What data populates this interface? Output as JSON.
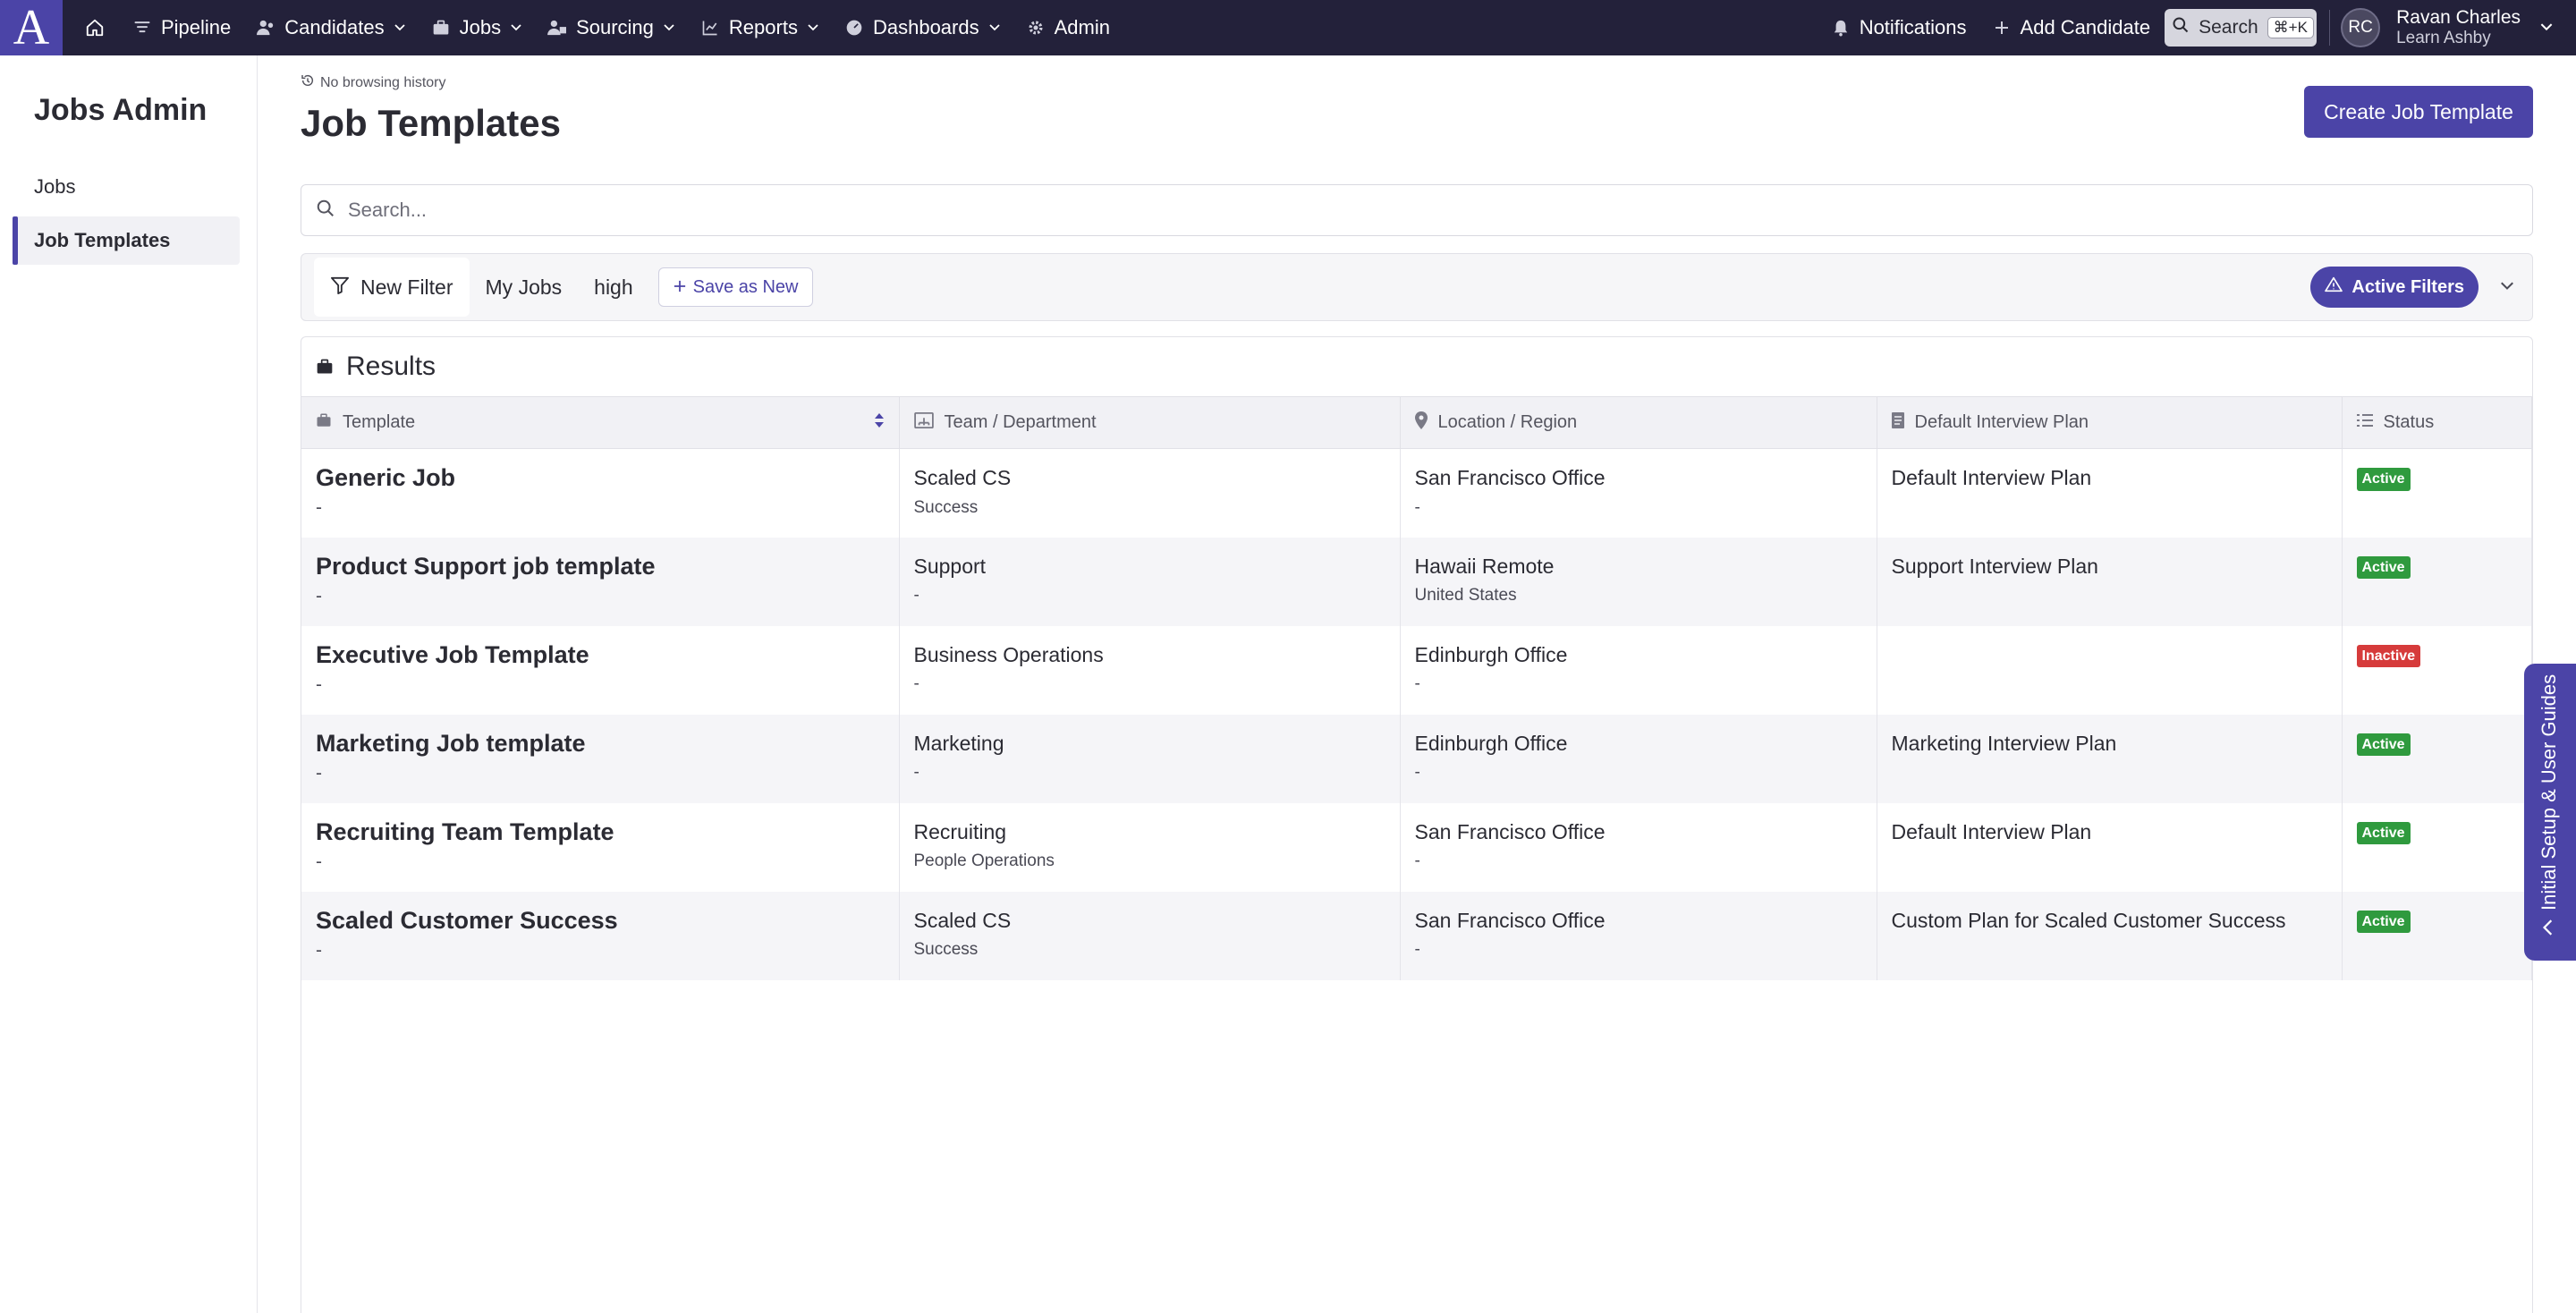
{
  "nav": {
    "logo": "A",
    "items": [
      {
        "label": "Pipeline",
        "icon": "filter-icon"
      },
      {
        "label": "Candidates",
        "icon": "users-icon"
      },
      {
        "label": "Jobs",
        "icon": "briefcase-icon"
      },
      {
        "label": "Sourcing",
        "icon": "sourcing-icon"
      },
      {
        "label": "Reports",
        "icon": "chart-line-icon"
      },
      {
        "label": "Dashboards",
        "icon": "gauge-icon"
      },
      {
        "label": "Admin",
        "icon": "gear-icon"
      }
    ],
    "notifications": "Notifications",
    "add_candidate": "Add Candidate",
    "search": "Search",
    "shortcut": "⌘+K",
    "user": {
      "initials": "RC",
      "name": "Ravan Charles",
      "org": "Learn Ashby"
    }
  },
  "sidebar": {
    "title": "Jobs Admin",
    "items": [
      {
        "label": "Jobs",
        "active": false
      },
      {
        "label": "Job Templates",
        "active": true
      }
    ]
  },
  "main": {
    "history": "No browsing history",
    "title": "Job Templates",
    "create_button": "Create Job Template",
    "search_placeholder": "Search...",
    "filters": {
      "tabs": [
        "New Filter",
        "My Jobs",
        "high"
      ],
      "save_as_new": "Save as New",
      "active_filters": "Active Filters"
    },
    "results": {
      "title": "Results",
      "columns": [
        "Template",
        "Team / Department",
        "Location / Region",
        "Default Interview Plan",
        "Status"
      ],
      "rows": [
        {
          "template": "Generic Job",
          "template_sub": "-",
          "team": "Scaled CS",
          "department": "Success",
          "location": "San Francisco Office",
          "region": "-",
          "plan": "Default Interview Plan",
          "status": "Active"
        },
        {
          "template": "Product Support job template",
          "template_sub": "-",
          "team": "Support",
          "department": "-",
          "location": "Hawaii Remote",
          "region": "United States",
          "plan": "Support Interview Plan",
          "status": "Active"
        },
        {
          "template": "Executive Job Template",
          "template_sub": "-",
          "team": "Business Operations",
          "department": "-",
          "location": "Edinburgh Office",
          "region": "-",
          "plan": "",
          "status": "Inactive"
        },
        {
          "template": "Marketing Job template",
          "template_sub": "-",
          "team": "Marketing",
          "department": "-",
          "location": "Edinburgh Office",
          "region": "-",
          "plan": "Marketing Interview Plan",
          "status": "Active"
        },
        {
          "template": "Recruiting Team Template",
          "template_sub": "-",
          "team": "Recruiting",
          "department": "People Operations",
          "location": "San Francisco Office",
          "region": "-",
          "plan": "Default Interview Plan",
          "status": "Active"
        },
        {
          "template": "Scaled Customer Success",
          "template_sub": "-",
          "team": "Scaled CS",
          "department": "Success",
          "location": "San Francisco Office",
          "region": "-",
          "plan": "Custom Plan for Scaled Customer Success",
          "status": "Active"
        }
      ]
    }
  },
  "guide_tab": "Initial Setup & User Guides",
  "colors": {
    "nav_bg": "#23213a",
    "brand": "#4b44a7",
    "active": "#2f9a3e",
    "inactive": "#d63b3b"
  }
}
